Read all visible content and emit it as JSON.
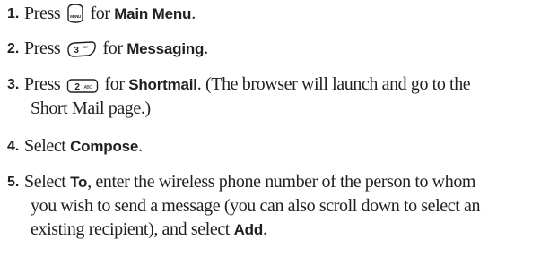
{
  "steps": [
    {
      "number": "1.",
      "pre": "Press",
      "key_icon": "menu-key-icon",
      "key_label": "MENU",
      "mid": "for",
      "keyword": "Main Menu",
      "post": "."
    },
    {
      "number": "2.",
      "pre": "Press",
      "key_icon": "3-def-key-icon",
      "key_label": "3",
      "key_sub": "DEF",
      "mid": "for",
      "keyword": "Messaging",
      "post": "."
    },
    {
      "number": "3.",
      "pre": "Press",
      "key_icon": "2-abc-key-icon",
      "key_label": "2",
      "key_sub": "ABC",
      "mid": "for",
      "keyword": "Shortmail",
      "post": ". (The browser will launch and go to the",
      "line2": "Short Mail page.)"
    },
    {
      "number": "4.",
      "pre": "Select",
      "keyword": "Compose",
      "post": "."
    },
    {
      "number": "5.",
      "pre": "Select",
      "keyword": "To",
      "post": ", enter the wireless phone number of the person to whom",
      "line2": "you wish to send a message (you can also scroll down to select an",
      "line3_pre": "existing recipient), and select",
      "line3_keyword": "Add",
      "line3_post": "."
    }
  ]
}
